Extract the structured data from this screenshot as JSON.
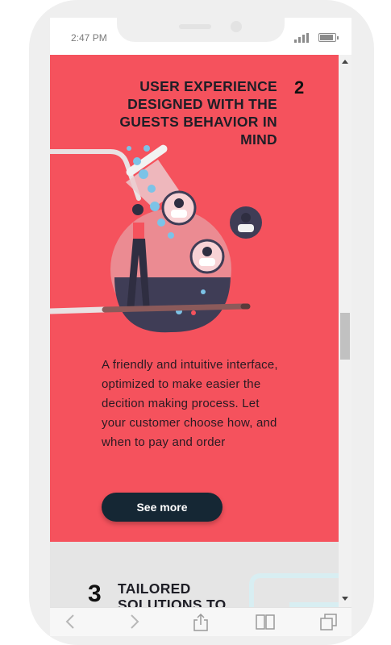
{
  "status_bar": {
    "time": "2:47 PM"
  },
  "feature": {
    "number": "2",
    "title": "USER EXPERIENCE DESIGNED WITH THE GUESTS BEHAVIOR IN MIND",
    "description": "A friendly and intuitive interface, optimized to make easier the decition making process. Let your customer choose how, and when to pay and order",
    "button_label": "See more"
  },
  "next_feature": {
    "number": "3",
    "title": "TAILORED SOLUTIONS TO"
  },
  "browser_toolbar": {
    "icons": [
      "back-arrow-icon",
      "forward-arrow-icon",
      "share-icon",
      "bookmarks-icon",
      "tabs-icon"
    ]
  },
  "colors": {
    "accent_red": "#f5525d",
    "button_dark": "#152734",
    "section_gray": "#e5e5e5",
    "frame_gray": "#efefef"
  }
}
